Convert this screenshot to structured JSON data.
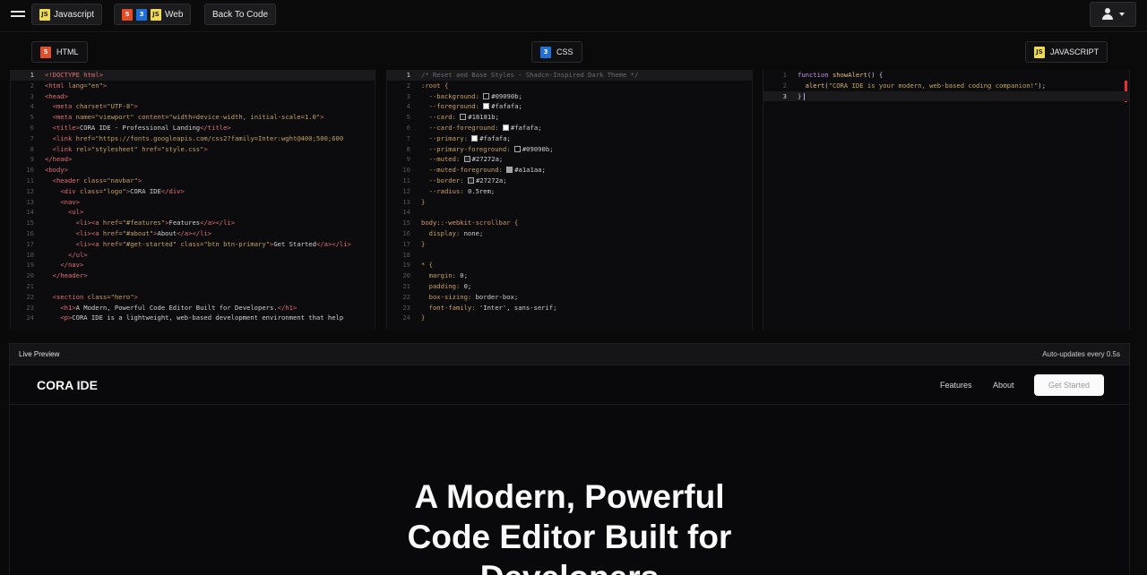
{
  "topbar": {
    "tabs": [
      {
        "label": "Javascript"
      },
      {
        "label": "Web"
      },
      {
        "label": "Back To Code"
      }
    ],
    "icons": {
      "js": "JS",
      "html": "5",
      "css": "3"
    }
  },
  "panels": {
    "html_label": "HTML",
    "css_label": "CSS",
    "js_label": "JAVASCRIPT"
  },
  "preview": {
    "title": "Live Preview",
    "auto_update": "Auto-updates every 0.5s",
    "logo": "CORA IDE",
    "nav_links": [
      "Features",
      "About"
    ],
    "cta": "Get Started",
    "hero_lines": [
      "A Modern, Powerful",
      "Code Editor Built for",
      "Developers"
    ]
  },
  "html_code": [
    [
      [
        "c-tag",
        "<!DOCTYPE html>"
      ]
    ],
    [
      [
        "c-tag",
        "<html "
      ],
      [
        "c-attr",
        "lang="
      ],
      [
        "c-str",
        "\"en\""
      ],
      [
        "c-tag",
        ">"
      ]
    ],
    [
      [
        "c-tag",
        "<head>"
      ]
    ],
    [
      [
        "",
        "  "
      ],
      [
        "c-tag",
        "<meta "
      ],
      [
        "c-attr",
        "charset="
      ],
      [
        "c-str",
        "\"UTF-8\""
      ],
      [
        "c-tag",
        ">"
      ]
    ],
    [
      [
        "",
        "  "
      ],
      [
        "c-tag",
        "<meta "
      ],
      [
        "c-attr",
        "name="
      ],
      [
        "c-str",
        "\"viewport\" "
      ],
      [
        "c-attr",
        "content="
      ],
      [
        "c-str",
        "\"width=device-width, initial-scale=1.0\""
      ],
      [
        "c-tag",
        ">"
      ]
    ],
    [
      [
        "",
        "  "
      ],
      [
        "c-tag",
        "<title>"
      ],
      [
        "",
        "CORA IDE - Professional Landing"
      ],
      [
        "c-tag",
        "</title>"
      ]
    ],
    [
      [
        "",
        "  "
      ],
      [
        "c-tag",
        "<link "
      ],
      [
        "c-attr",
        "href="
      ],
      [
        "c-str",
        "\"https://fonts.googleapis.com/css2?family=Inter:wght@400;500;600"
      ]
    ],
    [
      [
        "",
        "  "
      ],
      [
        "c-tag",
        "<link "
      ],
      [
        "c-attr",
        "rel="
      ],
      [
        "c-str",
        "\"stylesheet\" "
      ],
      [
        "c-attr",
        "href="
      ],
      [
        "c-str",
        "\"style.css\""
      ],
      [
        "c-tag",
        ">"
      ]
    ],
    [
      [
        "c-tag",
        "</head>"
      ]
    ],
    [
      [
        "c-tag",
        "<body>"
      ]
    ],
    [
      [
        "",
        "  "
      ],
      [
        "c-tag",
        "<header "
      ],
      [
        "c-attr",
        "class="
      ],
      [
        "c-str",
        "\"navbar\""
      ],
      [
        "c-tag",
        ">"
      ]
    ],
    [
      [
        "",
        "    "
      ],
      [
        "c-tag",
        "<div "
      ],
      [
        "c-attr",
        "class="
      ],
      [
        "c-str",
        "\"logo\""
      ],
      [
        "c-tag",
        ">"
      ],
      [
        "",
        "CORA IDE"
      ],
      [
        "c-tag",
        "</div>"
      ]
    ],
    [
      [
        "",
        "    "
      ],
      [
        "c-tag",
        "<nav>"
      ]
    ],
    [
      [
        "",
        "      "
      ],
      [
        "c-tag",
        "<ul>"
      ]
    ],
    [
      [
        "",
        "        "
      ],
      [
        "c-tag",
        "<li><a "
      ],
      [
        "c-attr",
        "href="
      ],
      [
        "c-str",
        "\"#features\""
      ],
      [
        "c-tag",
        ">"
      ],
      [
        "",
        "Features"
      ],
      [
        "c-tag",
        "</a></li>"
      ]
    ],
    [
      [
        "",
        "        "
      ],
      [
        "c-tag",
        "<li><a "
      ],
      [
        "c-attr",
        "href="
      ],
      [
        "c-str",
        "\"#about\""
      ],
      [
        "c-tag",
        ">"
      ],
      [
        "",
        "About"
      ],
      [
        "c-tag",
        "</a></li>"
      ]
    ],
    [
      [
        "",
        "        "
      ],
      [
        "c-tag",
        "<li><a "
      ],
      [
        "c-attr",
        "href="
      ],
      [
        "c-str",
        "\"#get-started\" "
      ],
      [
        "c-attr",
        "class="
      ],
      [
        "c-str",
        "\"btn btn-primary\""
      ],
      [
        "c-tag",
        ">"
      ],
      [
        "",
        "Get Started"
      ],
      [
        "c-tag",
        "</a></li>"
      ]
    ],
    [
      [
        "",
        "      "
      ],
      [
        "c-tag",
        "</ul>"
      ]
    ],
    [
      [
        "",
        "    "
      ],
      [
        "c-tag",
        "</nav>"
      ]
    ],
    [
      [
        "",
        "  "
      ],
      [
        "c-tag",
        "</header>"
      ]
    ],
    [
      [
        "",
        ""
      ]
    ],
    [
      [
        "",
        "  "
      ],
      [
        "c-tag",
        "<section "
      ],
      [
        "c-attr",
        "class="
      ],
      [
        "c-str",
        "\"hero\""
      ],
      [
        "c-tag",
        ">"
      ]
    ],
    [
      [
        "",
        "    "
      ],
      [
        "c-tag",
        "<h1>"
      ],
      [
        "",
        "A Modern, Powerful Code Editor Built for Developers."
      ],
      [
        "c-tag",
        "</h1>"
      ]
    ],
    [
      [
        "",
        "    "
      ],
      [
        "c-tag",
        "<p>"
      ],
      [
        "",
        "CORA IDE is a lightweight, web-based development environment that help"
      ]
    ]
  ],
  "css_code": [
    [
      [
        "c-com",
        "/* Reset and Base Styles - Shadcn-Inspired Dark Theme */"
      ]
    ],
    [
      [
        "c-sel",
        ":root {"
      ]
    ],
    [
      [
        "",
        "  "
      ],
      [
        "c-prop",
        "--background: "
      ],
      [
        "sw",
        "#09090b"
      ],
      [
        "",
        "#09090b;"
      ]
    ],
    [
      [
        "",
        "  "
      ],
      [
        "c-prop",
        "--foreground: "
      ],
      [
        "sw",
        "#fafafa"
      ],
      [
        "",
        "#fafafa;"
      ]
    ],
    [
      [
        "",
        "  "
      ],
      [
        "c-prop",
        "--card: "
      ],
      [
        "sw",
        "#18181b"
      ],
      [
        "",
        "#18181b;"
      ]
    ],
    [
      [
        "",
        "  "
      ],
      [
        "c-prop",
        "--card-foreground: "
      ],
      [
        "sw",
        "#fafafa"
      ],
      [
        "",
        "#fafafa;"
      ]
    ],
    [
      [
        "",
        "  "
      ],
      [
        "c-prop",
        "--primary: "
      ],
      [
        "sw",
        "#fafafa"
      ],
      [
        "",
        "#fafafa;"
      ]
    ],
    [
      [
        "",
        "  "
      ],
      [
        "c-prop",
        "--primary-foreground: "
      ],
      [
        "sw",
        "#09090b"
      ],
      [
        "",
        "#09090b;"
      ]
    ],
    [
      [
        "",
        "  "
      ],
      [
        "c-prop",
        "--muted: "
      ],
      [
        "sw",
        "#27272a"
      ],
      [
        "",
        "#27272a;"
      ]
    ],
    [
      [
        "",
        "  "
      ],
      [
        "c-prop",
        "--muted-foreground: "
      ],
      [
        "sw",
        "#a1a1aa"
      ],
      [
        "",
        "#a1a1aa;"
      ]
    ],
    [
      [
        "",
        "  "
      ],
      [
        "c-prop",
        "--border: "
      ],
      [
        "sw",
        "#27272a"
      ],
      [
        "",
        "#27272a;"
      ]
    ],
    [
      [
        "",
        "  "
      ],
      [
        "c-prop",
        "--radius: "
      ],
      [
        "",
        "0.5rem;"
      ]
    ],
    [
      [
        "c-sel",
        "}"
      ]
    ],
    [
      [
        "",
        ""
      ]
    ],
    [
      [
        "c-sel",
        "body::-webkit-scrollbar {"
      ]
    ],
    [
      [
        "",
        "  "
      ],
      [
        "c-prop",
        "display: "
      ],
      [
        "",
        "none;"
      ]
    ],
    [
      [
        "c-sel",
        "}"
      ]
    ],
    [
      [
        "",
        ""
      ]
    ],
    [
      [
        "c-sel",
        "* {"
      ]
    ],
    [
      [
        "",
        "  "
      ],
      [
        "c-prop",
        "margin: "
      ],
      [
        "",
        "0;"
      ]
    ],
    [
      [
        "",
        "  "
      ],
      [
        "c-prop",
        "padding: "
      ],
      [
        "",
        "0;"
      ]
    ],
    [
      [
        "",
        "  "
      ],
      [
        "c-prop",
        "box-sizing: "
      ],
      [
        "",
        "border-box;"
      ]
    ],
    [
      [
        "",
        "  "
      ],
      [
        "c-prop",
        "font-family: "
      ],
      [
        "",
        "'Inter', sans-serif;"
      ]
    ],
    [
      [
        "c-sel",
        "}"
      ]
    ]
  ],
  "js_code": [
    [
      [
        "c-kw",
        "function "
      ],
      [
        "c-fn",
        "showAlert"
      ],
      [
        "",
        "() {"
      ]
    ],
    [
      [
        "",
        "  "
      ],
      [
        "c-fn",
        "alert"
      ],
      [
        "",
        "("
      ],
      [
        "c-str",
        "\"CORA IDE is your modern, web-based coding companion!\""
      ],
      [
        "",
        ");"
      ]
    ],
    [
      [
        "",
        "}"
      ]
    ]
  ],
  "colors": {
    "background": "#0a0a0b",
    "accent_red": "#e5322d",
    "foreground": "#fafafa"
  }
}
